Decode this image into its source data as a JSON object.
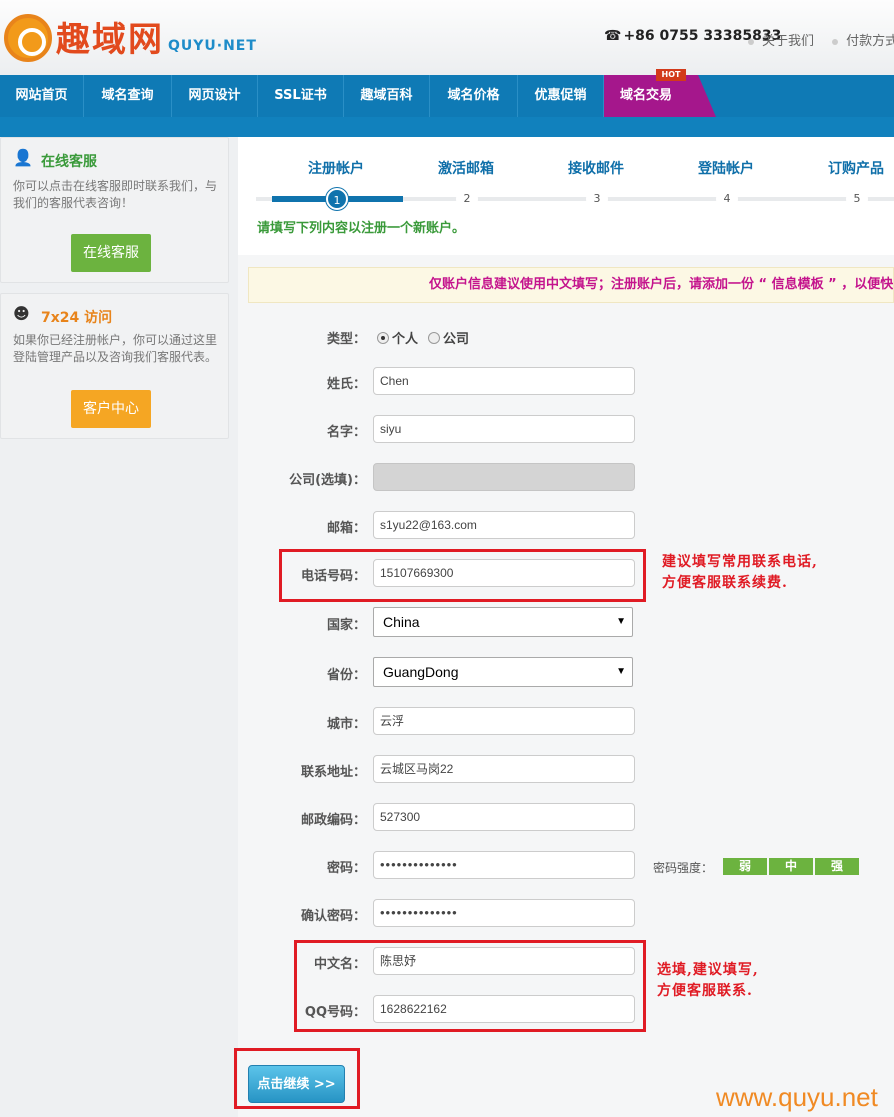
{
  "header": {
    "logo_cn": "趣域网",
    "logo_en": "QUYU·NET",
    "phone": "+86 0755 33385833",
    "links": [
      "关于我们",
      "付款方式"
    ]
  },
  "nav": {
    "items": [
      "网站首页",
      "域名查询",
      "网页设计",
      "SSL证书",
      "趣域百科",
      "域名价格",
      "优惠促销"
    ],
    "hot_item": "域名交易",
    "hot_badge": "HOT"
  },
  "sidebar": {
    "service": {
      "title": "在线客服",
      "text": "你可以点击在线客服即时联系我们，与我们的客服代表咨询！",
      "button": "在线客服"
    },
    "visit": {
      "title": "7x24 访问",
      "text": "如果你已经注册帐户，你可以通过这里登陆管理产品以及咨询我们客服代表。",
      "button": "客户中心"
    }
  },
  "steps": {
    "labels": [
      "注册帐户",
      "激活邮箱",
      "接收邮件",
      "登陆帐户",
      "订购产品"
    ],
    "numbers": [
      "1",
      "2",
      "3",
      "4",
      "5"
    ],
    "current": 1
  },
  "hint": "请填写下列内容以注册一个新账户。",
  "notice": "仅账户信息建议使用中文填写；注册账户后，请添加一份 “ 信息模板 ” ，以便快速",
  "form": {
    "type_label": "类型：",
    "type_options": [
      "个人",
      "公司"
    ],
    "type_selected": "个人",
    "surname_label": "姓氏：",
    "surname": "Chen",
    "given_label": "名字：",
    "given": "siyu",
    "company_label": "公司(选填)：",
    "company": "",
    "email_label": "邮箱：",
    "email": "s1yu22@163.com",
    "phone_label": "电话号码：",
    "phone": "15107669300",
    "country_label": "国家：",
    "country": "China",
    "province_label": "省份：",
    "province": "GuangDong",
    "city_label": "城市：",
    "city": "云浮",
    "address_label": "联系地址：",
    "address": "云城区马岗22",
    "zip_label": "邮政编码：",
    "zip": "527300",
    "password_label": "密码：",
    "password": "••••••••••••••",
    "confirm_label": "确认密码：",
    "confirm": "••••••••••••••",
    "strength_label": "密码强度：",
    "strength": [
      "弱",
      "中",
      "强"
    ],
    "cn_name_label": "中文名：",
    "cn_name": "陈思妤",
    "qq_label": "QQ号码：",
    "qq": "1628622162",
    "submit": "点击继续 >>"
  },
  "annotations": {
    "phone_note": [
      "建议填写常用联系电话,",
      "方便客服联系续费."
    ],
    "optional_note": [
      "选填,建议填写,",
      "方便客服联系."
    ]
  },
  "watermark": "www.quyu.net",
  "colors": {
    "nav": "#0f7ab5",
    "hot": "#a5178c",
    "accent_red": "#e01b24",
    "green": "#6cb33f"
  }
}
